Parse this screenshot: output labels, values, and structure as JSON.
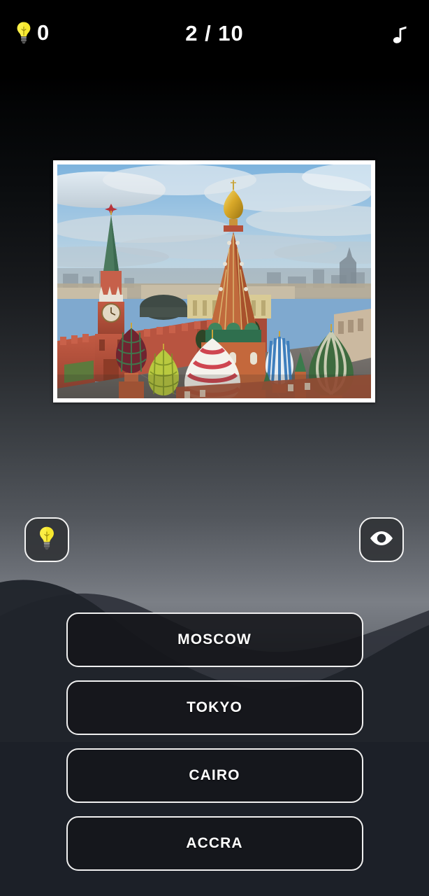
{
  "header": {
    "hint_icon": "lightbulb-icon",
    "hint_count": "0",
    "progress": "2 / 10",
    "sound_icon": "music-note-icon"
  },
  "question": {
    "image_alt": "Aerial view of Red Square, Moscow: Kremlin wall, Spasskaya Tower and St. Basil's Cathedral domes",
    "landmark": "Red Square, Moscow"
  },
  "actions": [
    {
      "name": "hint-button",
      "icon": "lightbulb-icon"
    },
    {
      "name": "reveal-button",
      "icon": "eye-icon"
    }
  ],
  "answers": [
    {
      "label": "MOSCOW"
    },
    {
      "label": "TOKYO"
    },
    {
      "label": "CAIRO"
    },
    {
      "label": "ACCRA"
    }
  ],
  "colors": {
    "accent": "#f4e03c",
    "border": "#f0f0f0",
    "text": "#ffffff",
    "header_bg": "#000000",
    "button_bg": "#14161a"
  }
}
